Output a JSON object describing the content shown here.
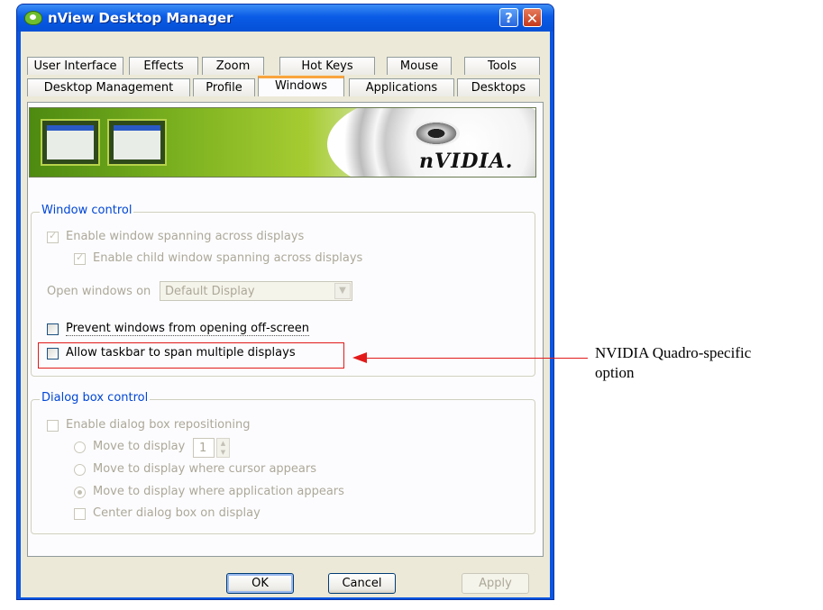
{
  "window": {
    "title": "nView Desktop Manager",
    "help_label": "?",
    "close_label": "✕"
  },
  "tabs_row1": [
    "User Interface",
    "Effects",
    "Zoom",
    "Hot Keys",
    "Mouse",
    "Tools"
  ],
  "tabs_row2": [
    "Desktop Management",
    "Profile",
    "Windows",
    "Applications",
    "Desktops"
  ],
  "active_tab": "Windows",
  "banner": {
    "brand": "nVIDIA."
  },
  "window_control": {
    "legend": "Window control",
    "enable_spanning": {
      "label": "Enable window spanning across displays",
      "checked": true,
      "enabled": false
    },
    "enable_child_spanning": {
      "label": "Enable child window spanning across displays",
      "checked": true,
      "enabled": false
    },
    "open_windows_on": {
      "label": "Open windows on",
      "value": "Default Display",
      "enabled": false
    },
    "prevent_offscreen": {
      "label": "Prevent windows from opening off-screen",
      "checked": false,
      "enabled": true
    },
    "allow_taskbar_span": {
      "label": "Allow taskbar to span multiple displays",
      "checked": false,
      "enabled": true
    }
  },
  "dialog_control": {
    "legend": "Dialog box control",
    "enable_repositioning": {
      "label": "Enable dialog box repositioning",
      "checked": false
    },
    "move_to_display": {
      "label": "Move to display",
      "value": "1"
    },
    "move_cursor": {
      "label": "Move to display where cursor appears"
    },
    "move_application": {
      "label": "Move to display where application appears",
      "selected": true
    },
    "center_dialog": {
      "label": "Center dialog box on display",
      "checked": false
    }
  },
  "buttons": {
    "ok": "OK",
    "cancel": "Cancel",
    "apply": "Apply"
  },
  "callout": {
    "line1": "NVIDIA Quadro-specific",
    "line2": "option",
    "color": "#e21a1a"
  },
  "colors": {
    "titlebar": "#0a5be6",
    "face": "#ece9d8",
    "group_legend": "#0046d5",
    "tab_highlight": "#f9a43d"
  }
}
